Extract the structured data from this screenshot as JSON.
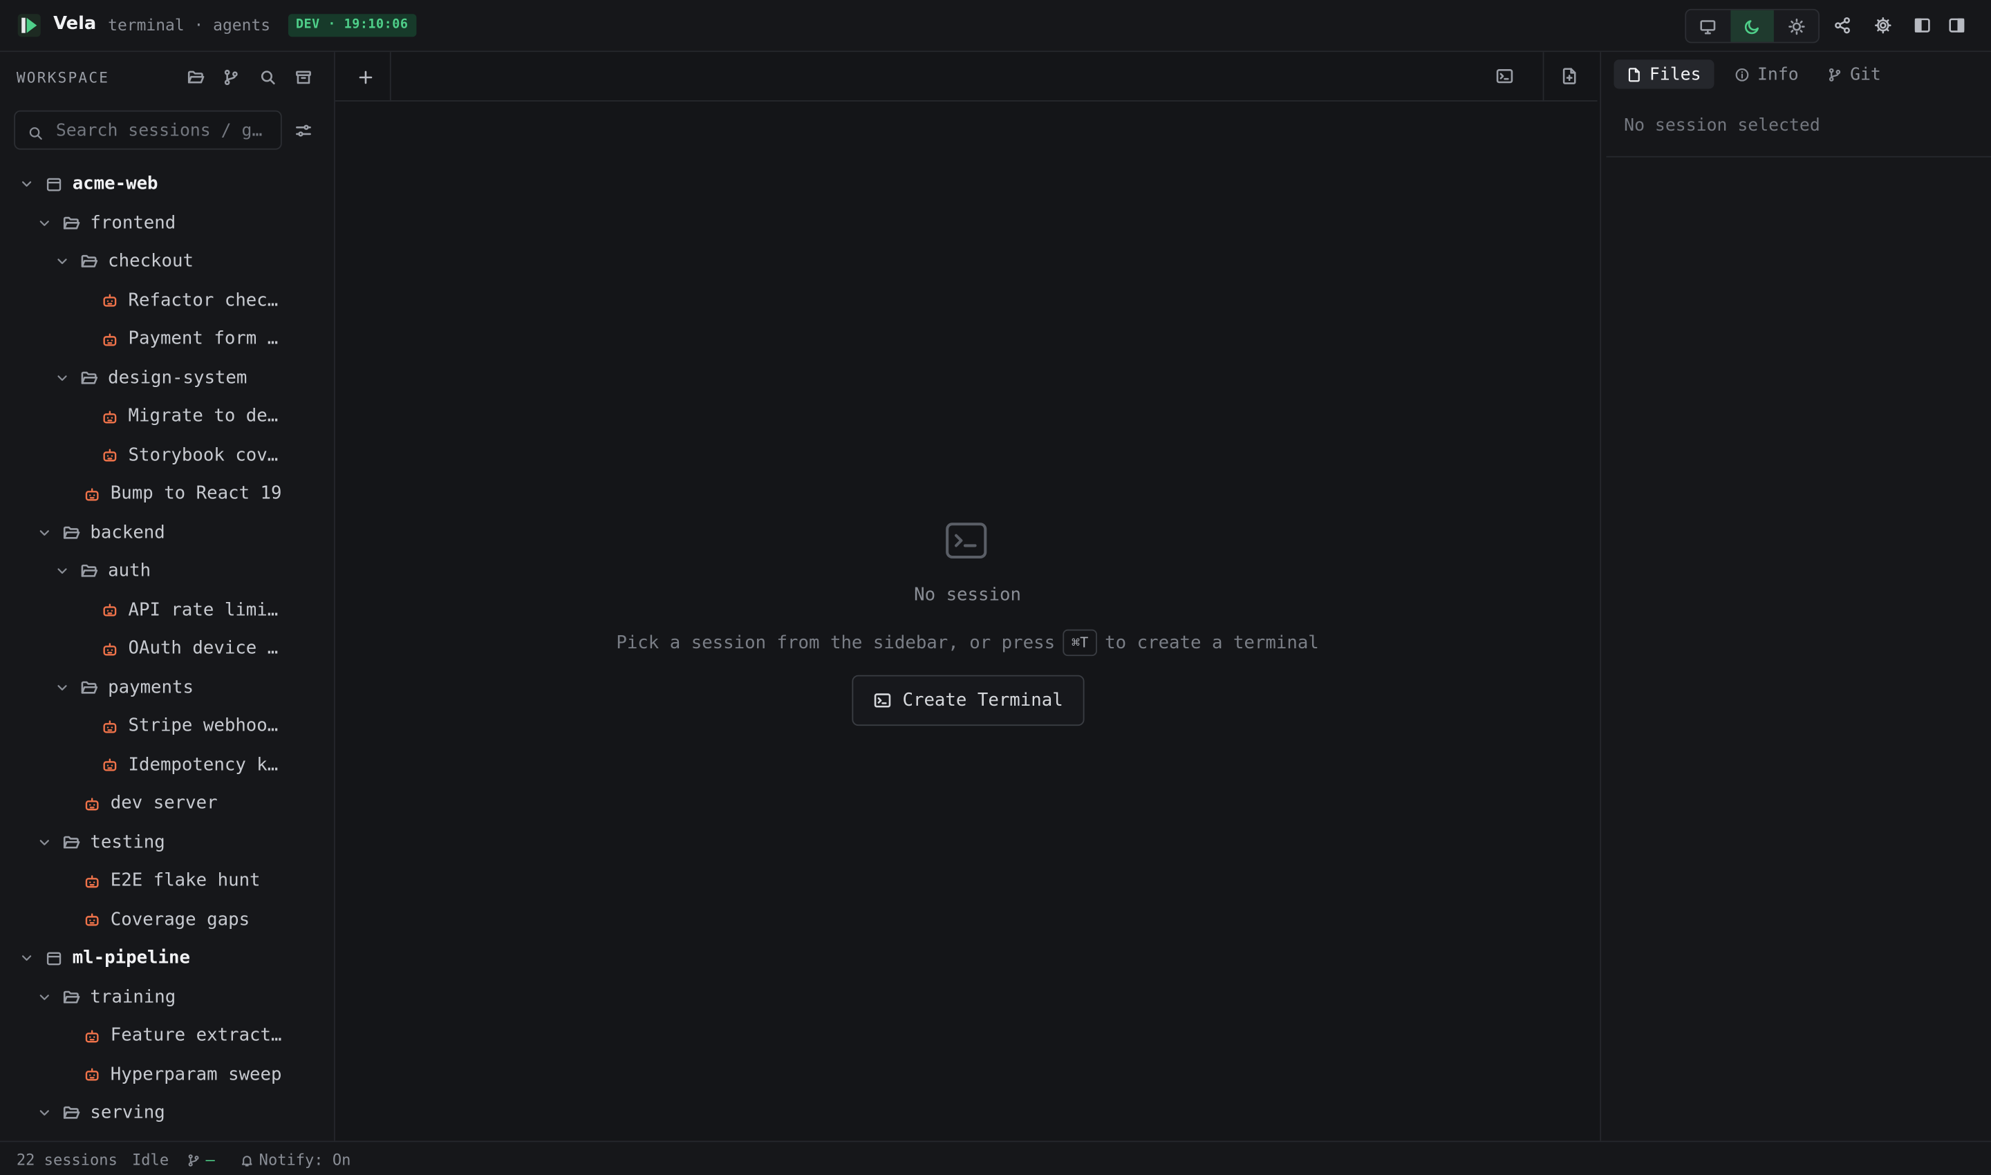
{
  "titlebar": {
    "app_name": "Vela",
    "subtitle": "terminal · agents",
    "env_badge": "DEV · 19:10:06",
    "accent_color": "#4fd08a",
    "icons": [
      "monitor-icon",
      "moon-icon",
      "sun-icon",
      "share-icon",
      "settings-icon",
      "panel-left-icon",
      "panel-right-icon"
    ],
    "theme_selected": "dark"
  },
  "sidebar": {
    "title": "WORKSPACE",
    "header_icons": [
      "folder-open-icon",
      "git-branch-icon",
      "search-icon",
      "archive-icon"
    ],
    "search_placeholder": "Search sessions / g…",
    "filter_icon": "sliders-icon",
    "tree": [
      {
        "type": "project",
        "depth": 0,
        "label": "acme-web"
      },
      {
        "type": "folder",
        "depth": 1,
        "label": "frontend"
      },
      {
        "type": "folder",
        "depth": 2,
        "label": "checkout"
      },
      {
        "type": "session",
        "depth": 3,
        "label": "Refactor chec…"
      },
      {
        "type": "session",
        "depth": 3,
        "label": "Payment form …"
      },
      {
        "type": "folder",
        "depth": 2,
        "label": "design-system"
      },
      {
        "type": "session",
        "depth": 3,
        "label": "Migrate to de…"
      },
      {
        "type": "session",
        "depth": 3,
        "label": "Storybook cov…"
      },
      {
        "type": "session",
        "depth": 2,
        "label": "Bump to React 19"
      },
      {
        "type": "folder",
        "depth": 1,
        "label": "backend"
      },
      {
        "type": "folder",
        "depth": 2,
        "label": "auth"
      },
      {
        "type": "session",
        "depth": 3,
        "label": "API rate limi…"
      },
      {
        "type": "session",
        "depth": 3,
        "label": "OAuth device …"
      },
      {
        "type": "folder",
        "depth": 2,
        "label": "payments"
      },
      {
        "type": "session",
        "depth": 3,
        "label": "Stripe webhoo…"
      },
      {
        "type": "session",
        "depth": 3,
        "label": "Idempotency k…"
      },
      {
        "type": "session",
        "depth": 2,
        "label": "dev server"
      },
      {
        "type": "folder",
        "depth": 1,
        "label": "testing"
      },
      {
        "type": "session",
        "depth": 2,
        "label": "E2E flake hunt"
      },
      {
        "type": "session",
        "depth": 2,
        "label": "Coverage gaps"
      },
      {
        "type": "project",
        "depth": 0,
        "label": "ml-pipeline"
      },
      {
        "type": "folder",
        "depth": 1,
        "label": "training"
      },
      {
        "type": "session",
        "depth": 2,
        "label": "Feature extract…"
      },
      {
        "type": "session",
        "depth": 2,
        "label": "Hyperparam sweep"
      },
      {
        "type": "folder",
        "depth": 1,
        "label": "serving"
      }
    ]
  },
  "main": {
    "new_tab_label": "+",
    "empty_state": {
      "title": "No session",
      "hint_before": "Pick a session from the sidebar, or press",
      "shortcut": "⌘T",
      "hint_after": "to create a terminal",
      "button_label": "Create Terminal"
    }
  },
  "right_panel": {
    "tabs": [
      {
        "label": "Files",
        "icon": "file-icon",
        "active": true
      },
      {
        "label": "Info",
        "icon": "info-icon",
        "active": false
      },
      {
        "label": "Git",
        "icon": "git-branch-icon",
        "active": false
      }
    ],
    "empty_text": "No session selected"
  },
  "statusbar": {
    "sessions": "22 sessions",
    "state": "Idle",
    "branch": "—",
    "notify": "Notify: On"
  }
}
